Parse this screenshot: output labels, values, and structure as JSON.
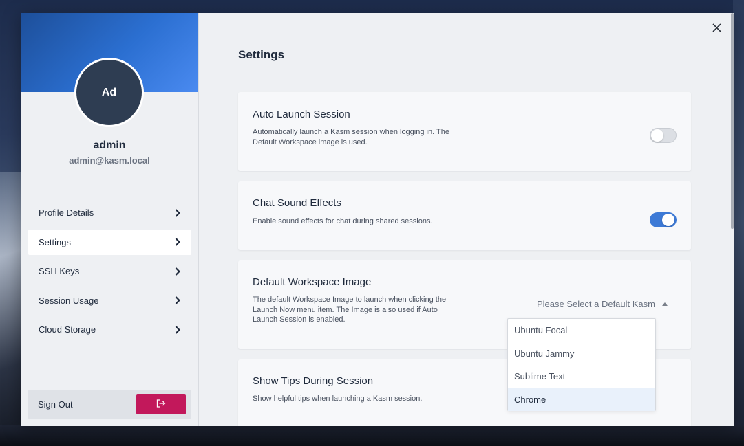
{
  "user": {
    "initials": "Ad",
    "name": "admin",
    "email": "admin@kasm.local"
  },
  "sidebar": {
    "items": [
      {
        "label": "Profile Details",
        "active": false
      },
      {
        "label": "Settings",
        "active": true
      },
      {
        "label": "SSH Keys",
        "active": false
      },
      {
        "label": "Session Usage",
        "active": false
      },
      {
        "label": "Cloud Storage",
        "active": false
      }
    ],
    "sign_out_label": "Sign Out"
  },
  "main": {
    "title": "Settings",
    "cards": {
      "auto_launch": {
        "title": "Auto Launch Session",
        "description": "Automatically launch a Kasm session when logging in. The Default Workspace image is used.",
        "enabled": false
      },
      "chat_sound": {
        "title": "Chat Sound Effects",
        "description": "Enable sound effects for chat during shared sessions.",
        "enabled": true
      },
      "default_image": {
        "title": "Default Workspace Image",
        "description": "The default Workspace Image to launch when clicking the Launch Now menu item. The Image is also used if Auto Launch Session is enabled.",
        "select_placeholder": "Please Select a Default Kasm"
      },
      "show_tips": {
        "title": "Show Tips During Session",
        "description": "Show helpful tips when launching a Kasm session."
      }
    },
    "dropdown": {
      "options": [
        "Ubuntu Focal",
        "Ubuntu Jammy",
        "Sublime Text",
        "Chrome"
      ],
      "highlighted": "Chrome"
    }
  },
  "colors": {
    "accent": "#3d7ad6",
    "sign_out": "#c2185b",
    "banner": "#2b6fd1"
  }
}
